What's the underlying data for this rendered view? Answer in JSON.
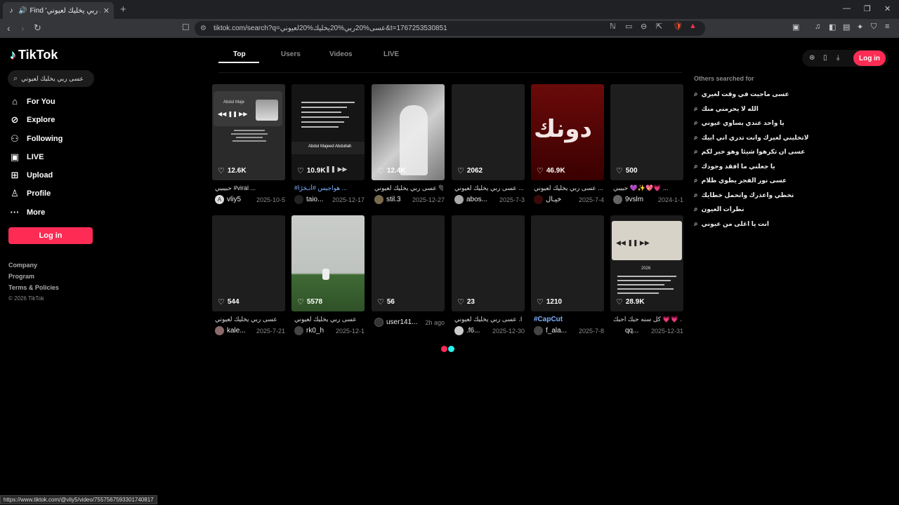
{
  "browser": {
    "tab_title": "Find 'عسى ربي يخليك لعيوني' o",
    "url": "tiktok.com/search?q=عسى%20ربي%20يخليك%20لعيوني&t=1767253530851",
    "status_url": "https://www.tiktok.com/@vliy5/video/7557567593301740817"
  },
  "brand": {
    "name": "TikTok",
    "accent": "#fe2c55",
    "cyan": "#25f4ee"
  },
  "sidebar": {
    "search_value": "عسى ربي يخليك لعيوني",
    "items": [
      {
        "label": "For You",
        "icon": "home-icon"
      },
      {
        "label": "Explore",
        "icon": "compass-icon"
      },
      {
        "label": "Following",
        "icon": "following-icon"
      },
      {
        "label": "LIVE",
        "icon": "live-icon"
      },
      {
        "label": "Upload",
        "icon": "upload-icon"
      },
      {
        "label": "Profile",
        "icon": "profile-icon"
      },
      {
        "label": "More",
        "icon": "more-icon"
      }
    ],
    "login_label": "Log in",
    "footer": [
      "Company",
      "Program",
      "Terms & Policies"
    ],
    "copyright": "© 2026 TikTok"
  },
  "search_tabs": [
    "Top",
    "Users",
    "Videos",
    "LIVE"
  ],
  "active_tab": "Top",
  "videos": [
    {
      "likes": "12.6K",
      "caption": "حبيبيي #viral ...",
      "user": "vliy5",
      "date": "2025-10-5",
      "avatar_letter": "A"
    },
    {
      "likes": "10.9K",
      "caption": "#هواجيس #أنـحَرًا ...",
      "user": "taio...",
      "date": "2025-12-17",
      "avatar_letter": ""
    },
    {
      "likes": "12.4K",
      "caption": "عسى ربي يخليك لعيوني 🖤 ...",
      "user": "stil.3",
      "date": "2025-12-27",
      "avatar_letter": ""
    },
    {
      "likes": "2062",
      "caption": "عسى ربي يخليك لعيوني ...",
      "user": "abos...",
      "date": "2025-7-3",
      "avatar_letter": ""
    },
    {
      "likes": "46.9K",
      "caption": "عسى ربي يخليك لعيوني ...",
      "user": "خيـال",
      "date": "2025-7-4",
      "avatar_letter": ""
    },
    {
      "likes": "500",
      "caption": "حبيبي 💜✨💖💗 ...",
      "user": "9vslm",
      "date": "2024-1-1",
      "avatar_letter": ""
    },
    {
      "likes": "544",
      "caption": "عسى ربي يخليك لعيوني",
      "user": "kale...",
      "date": "2025-7-21",
      "avatar_letter": ""
    },
    {
      "likes": "5578",
      "caption": "عسى ربي يخليك لعيوني",
      "user": "rk0_h",
      "date": "2025-12-1",
      "avatar_letter": ""
    },
    {
      "likes": "56",
      "caption": "",
      "user": "user141...",
      "date": "2h ago",
      "avatar_letter": ""
    },
    {
      "likes": "23",
      "caption": "عسى ربي يخليك لعيوني .I ...",
      "user": ".f6...",
      "date": "2025-12-30",
      "avatar_letter": ""
    },
    {
      "likes": "1210",
      "caption": "#CapCut",
      "user": "f_ala...",
      "date": "2025-7-8",
      "avatar_letter": ""
    },
    {
      "likes": "28.9K",
      "caption": "كل سنه حبك احبك 💗💗 ...",
      "user": "qq...",
      "date": "2025-12-31",
      "avatar_letter": ""
    }
  ],
  "thumb_texts": {
    "v1_header": "Abdul Maje",
    "v2_footer": "Abdul Majeed Abdullah",
    "v5_word": "دونك",
    "v12_year": "2026"
  },
  "others": {
    "title": "Others searched for",
    "items": [
      "عسى ماجيت في وقت لغيري",
      "الله لا يحرمني منك",
      "يا واحد عندي يساوي عيوني",
      "لاتخليني لغيرك وانت تدري اني ابيك",
      "عسى ان تكرهوا شيئا وهو خير لكم",
      "يا جعلني ما افقد وجودك",
      "عسى نور الفجر يطوي ظلام",
      "تخطي واعذرك واتحمل خطايك",
      "نظرات العيون",
      "انت يا اغلى من عيوني"
    ]
  },
  "topright": {
    "login_label": "Log in"
  }
}
